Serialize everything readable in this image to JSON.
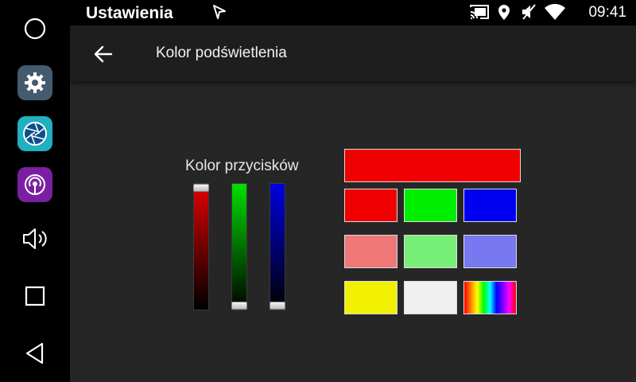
{
  "status_bar": {
    "app_title": "Ustawienia",
    "time": "09:41",
    "icons": [
      "navigation-icon",
      "cast-icon",
      "location-icon",
      "mute-icon",
      "wifi-icon"
    ]
  },
  "nav_rail": {
    "buttons": [
      "home-icon",
      "settings-app-icon",
      "camera-app-icon",
      "podcast-app-icon",
      "volume-icon",
      "recents-icon",
      "back-icon"
    ]
  },
  "header": {
    "title": "Kolor podświetlenia",
    "back_icon": "arrow-left-icon"
  },
  "color_picker": {
    "label": "Kolor przycisków",
    "red_level": 1.0,
    "green_level": 0.0,
    "blue_level": 0.0,
    "preview_color": "#f00000",
    "swatches": [
      [
        "#f00000",
        "#00ee00",
        "#0000f0"
      ],
      [
        "#f07878",
        "#78f078",
        "#7878f0"
      ],
      [
        "#f0f000",
        "#f0f0f0",
        "rainbow"
      ]
    ]
  }
}
